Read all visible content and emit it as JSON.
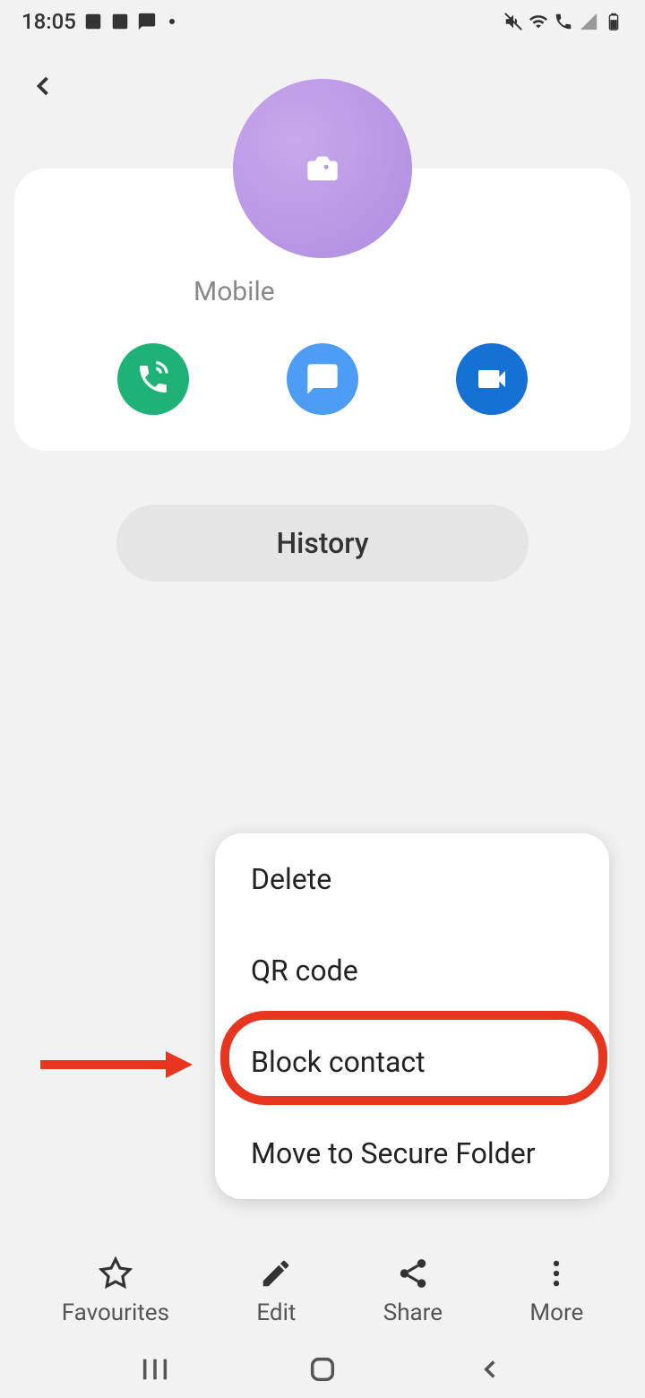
{
  "status_bar": {
    "time": "18:05"
  },
  "contact": {
    "phone_label": "Mobile"
  },
  "history_button": "History",
  "more_menu": {
    "items": [
      "Delete",
      "QR code",
      "Block contact",
      "Move to Secure Folder"
    ]
  },
  "bottom_nav": {
    "favourites": "Favourites",
    "edit": "Edit",
    "share": "Share",
    "more": "More"
  }
}
